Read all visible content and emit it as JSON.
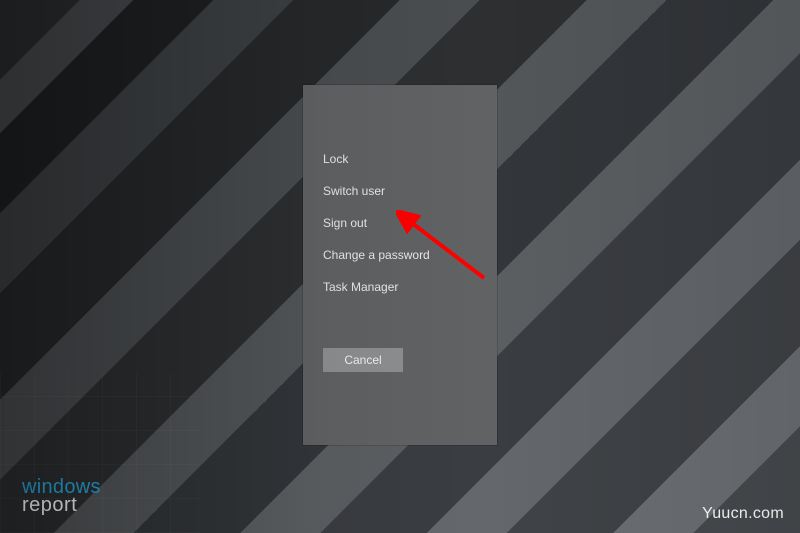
{
  "menu": {
    "items": [
      {
        "label": "Lock"
      },
      {
        "label": "Switch user"
      },
      {
        "label": "Sign out"
      },
      {
        "label": "Change a password"
      },
      {
        "label": "Task Manager"
      }
    ],
    "cancel_label": "Cancel"
  },
  "annotation": {
    "arrow_color": "#ff0000",
    "points_to": "task-manager"
  },
  "watermarks": {
    "left_line1": "windows",
    "left_line2": "report",
    "right": "Yuucn.com"
  }
}
